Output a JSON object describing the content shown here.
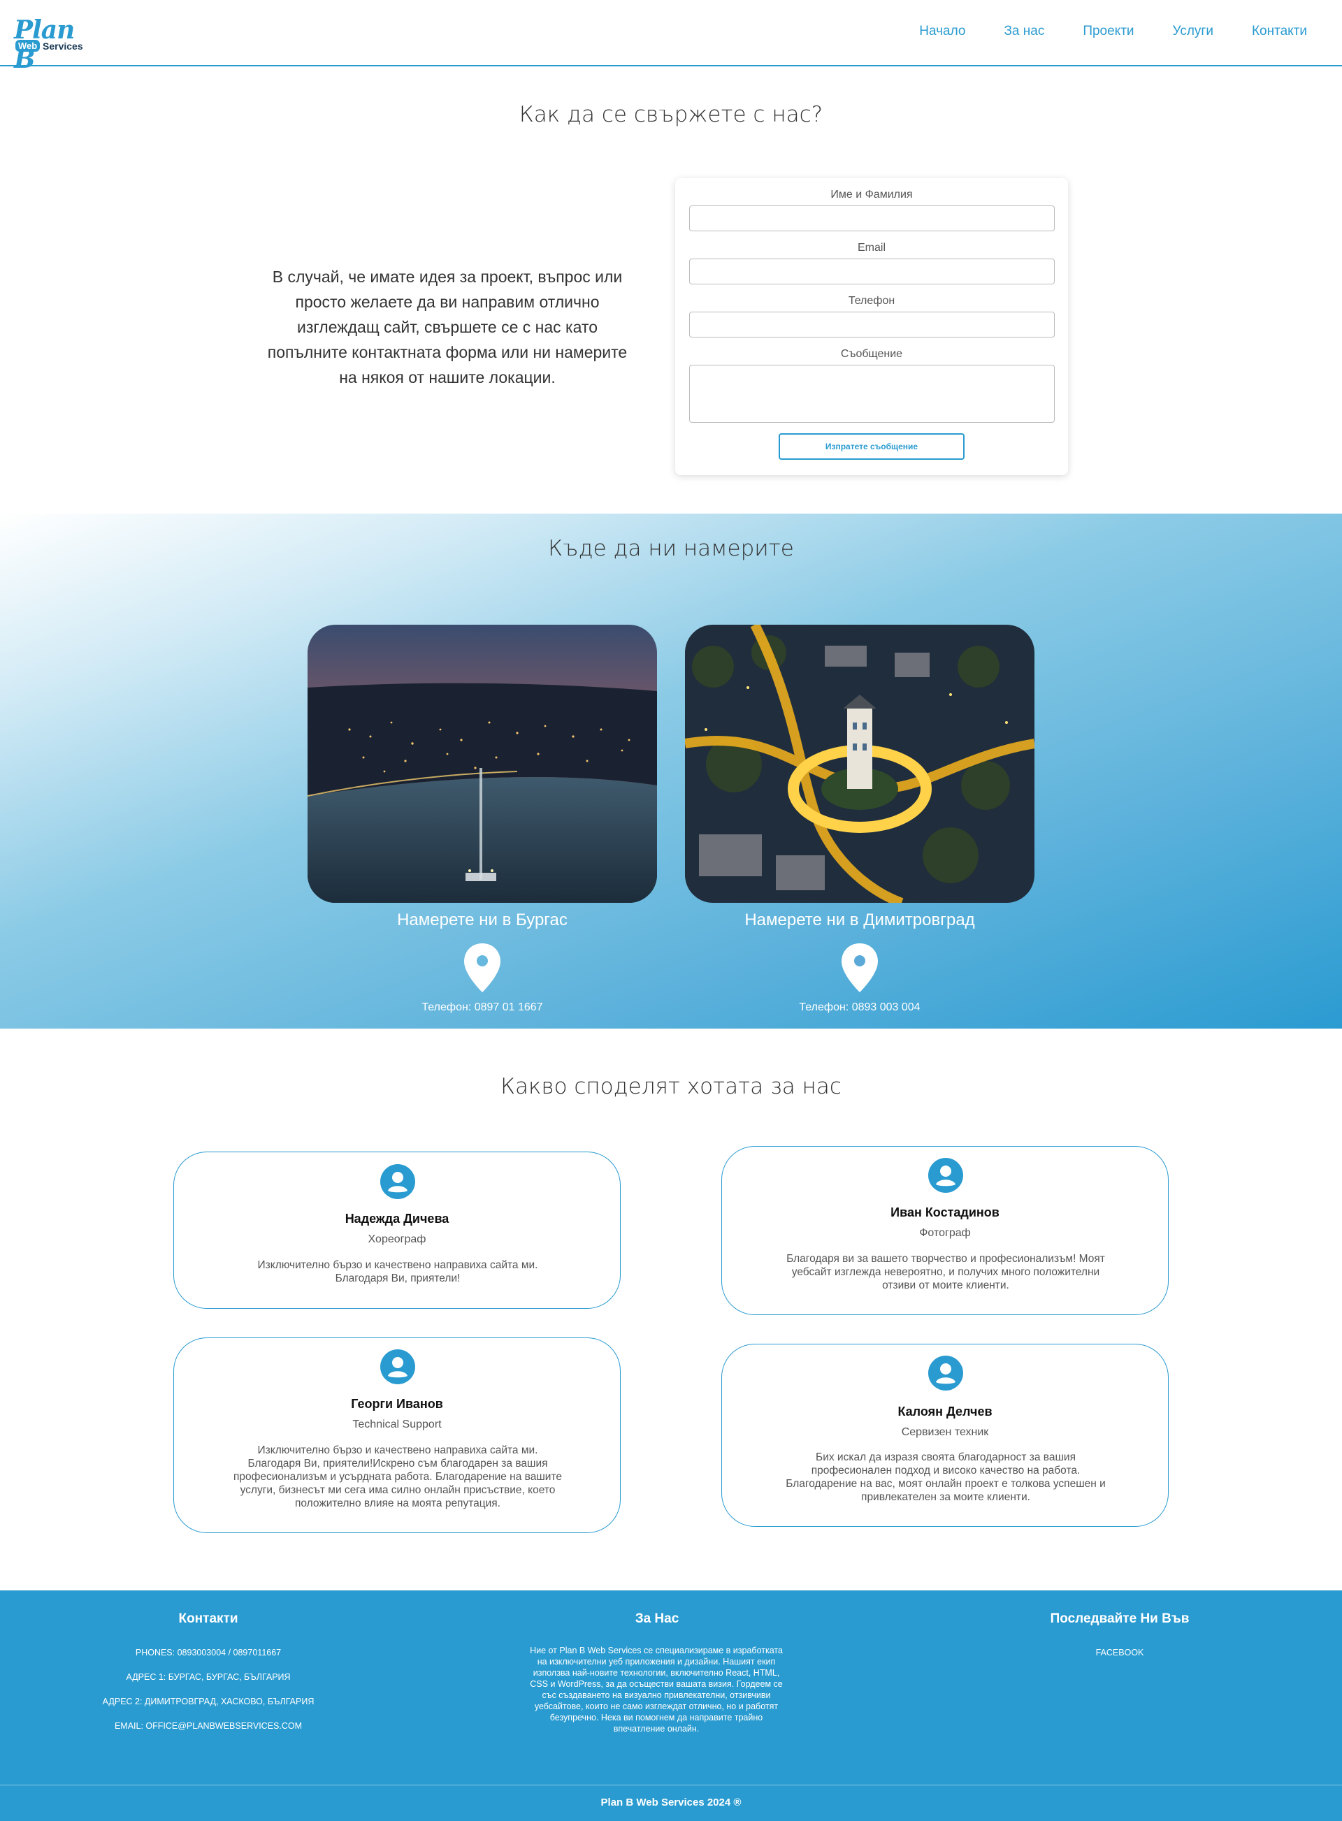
{
  "logo": {
    "plan": "Plan B",
    "web": "Web",
    "services": "Services"
  },
  "nav": [
    "Начало",
    "За нас",
    "Проекти",
    "Услуги",
    "Контакти"
  ],
  "contact": {
    "title": "Как да се свържете с нас?",
    "text": "В случай, че имате идея за проект, въпрос или просто желаете да ви направим отлично изглеждащ сайт, свършете се с нас като попълните контактната форма или ни намерите на някоя от нашите локации.",
    "form": {
      "name_label": "Име и Фамилия",
      "email_label": "Email",
      "phone_label": "Телефон",
      "message_label": "Съобщение",
      "submit_label": "Изпратете съобщение"
    }
  },
  "locations": {
    "title": "Къде да ни намерите",
    "items": [
      {
        "caption": "Намерете ни в Бургас",
        "phone": "Телефон: 0897 01 1667"
      },
      {
        "caption": "Намерете ни в Димитровград",
        "phone": "Телефон: 0893 003 004"
      }
    ]
  },
  "testimonials": {
    "title": "Какво споделят хотата за нас",
    "items": [
      {
        "name": "Надежда Дичева",
        "role": "Хореограф",
        "quote": "Изключително бързо и качествено направиха сайта ми. Благодаря Ви, приятели!"
      },
      {
        "name": "Иван Костадинов",
        "role": "Фотограф",
        "quote": "Благодаря ви за вашето творчество и професионализъм! Моят уебсайт изглежда невероятно, и получих много положителни отзиви от моите клиенти."
      },
      {
        "name": "Георги Иванов",
        "role": "Technical Support",
        "quote": "Изключително бързо и качествено направиха сайта ми. Благодаря Ви, приятели!Искрено съм благодарен за вашия професионализъм и усърдната работа. Благодарение на вашите услуги, бизнесът ми сега има силно онлайн присъствие, което положително влияе на моята репутация."
      },
      {
        "name": "Калоян Делчев",
        "role": "Сервизен техник",
        "quote": "Бих искал да изразя своята благодарност за вашия професионален подход и високо качество на работа. Благодарение на вас, моят онлайн проект е толкова успешен и привлекателен за моите клиенти."
      }
    ]
  },
  "footer": {
    "contacts_title": "Контакти",
    "phones": "PHONES: 0893003004 / 0897011667",
    "address1": "АДРЕС 1: БУРГАС, БУРГАС, БЪЛГАРИЯ",
    "address2": "АДРЕС 2: ДИМИТРОВГРАД, ХАСКОВО, БЪЛГАРИЯ",
    "email": "EMAIL: OFFICE@PLANBWEBSERVICES.COM",
    "about_title": "За Нас",
    "about_text": "Ние от Plan B Web Services се специализираме в изработката на изключителни уеб приложения и дизайни. Нашият екип използва най-новите технологии, включително React, HTML, CSS и WordPress, за да осъществи вашата визия. Гордеем се със създаването на визуално привлекателни, отзивчиви уебсайтове, които не само изглеждат отлично, но и работят безупречно. Нека ви помогнем да направите трайно впечатление онлайн.",
    "follow_title": "Последвайте Ни Във",
    "facebook": "FACEBOOK",
    "copyright": "Plan B Web Services 2024 ®"
  }
}
